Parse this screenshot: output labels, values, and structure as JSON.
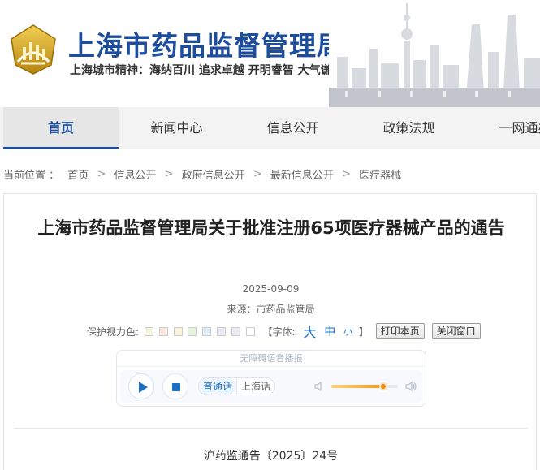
{
  "header": {
    "site_title": "上海市药品监督管理局",
    "motto": "上海城市精神：海纳百川  追求卓越  开明睿智  大气谦和",
    "brand_color": "#1d4e9e"
  },
  "nav": {
    "items": [
      {
        "label": "首页",
        "active": true
      },
      {
        "label": "新闻中心",
        "active": false
      },
      {
        "label": "信息公开",
        "active": false
      },
      {
        "label": "政策法规",
        "active": false
      },
      {
        "label": "一网通办",
        "active": false
      }
    ]
  },
  "breadcrumb": {
    "prefix": "当前位置 ：",
    "items": [
      "首页",
      "信息公开",
      "政府信息公开",
      "最新信息公开",
      "医疗器械"
    ],
    "separator": ">"
  },
  "article": {
    "title": "上海市药品监督管理局关于批准注册65项医疗器械产品的通告",
    "date": "2025-09-09",
    "source": "来源：市药品监管局",
    "doc_number": "沪药监通告〔2025〕24号"
  },
  "tools": {
    "eye_care_label": "保护视力色:",
    "swatch_colors": [
      "#f7f6e1",
      "#fbe6df",
      "#fbf3dc",
      "#e4f5dd",
      "#dff1f8",
      "#ececf4",
      "#ecedf0",
      "#ffffff"
    ],
    "font_label": "【字体:",
    "font_big": "大",
    "font_mid": "中",
    "font_small": "小",
    "font_close": "】",
    "print_button": "打印本页",
    "close_button": "关闭窗口"
  },
  "player": {
    "header": "无障碍语音播报",
    "lang_mandarin": "普通话",
    "lang_shanghai": "上海话",
    "volume_level": 0.78,
    "accent_color": "#1d6fc2"
  }
}
